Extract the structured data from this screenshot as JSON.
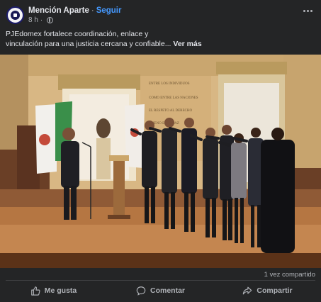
{
  "post": {
    "page_name": "Mención Aparte",
    "follow_label": "Seguir",
    "separator": "·",
    "time_ago": "8 h",
    "caption_line1": "PJEdomex fortalece coordinación, enlace y",
    "caption_line2": "vinculación para una justicia cercana y confiable...",
    "see_more": "Ver más",
    "shares": "1 vez compartido"
  },
  "actions": [
    {
      "label": "Me gusta",
      "icon": "thumbs-up-icon"
    },
    {
      "label": "Comentar",
      "icon": "comment-icon"
    },
    {
      "label": "Compartir",
      "icon": "share-icon"
    }
  ],
  "photo": {
    "wall_text": [
      "ENTRE LOS INDIVIDUOS",
      "COMO ENTRE LAS NACIONES",
      "EL RESPETO AL DERECHO",
      "AJENO ES LA PAZ"
    ]
  }
}
